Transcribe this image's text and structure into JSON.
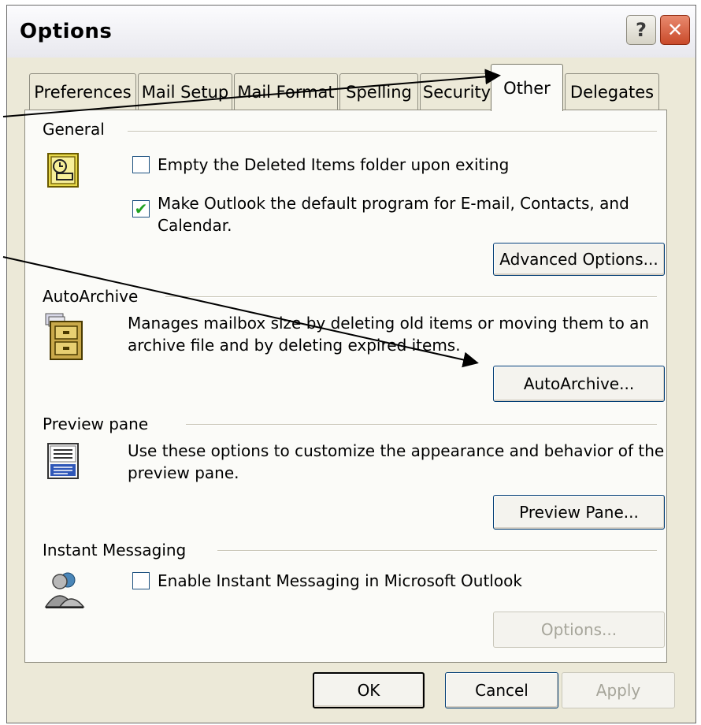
{
  "window": {
    "title": "Options"
  },
  "tabs": [
    {
      "label": "Preferences",
      "active": false
    },
    {
      "label": "Mail Setup",
      "active": false
    },
    {
      "label": "Mail Format",
      "active": false
    },
    {
      "label": "Spelling",
      "active": false
    },
    {
      "label": "Security",
      "active": false
    },
    {
      "label": "Other",
      "active": true
    },
    {
      "label": "Delegates",
      "active": false
    }
  ],
  "general": {
    "label": "General",
    "icon": "outlook-options-icon",
    "empty_deleted": {
      "label": "Empty the Deleted Items folder upon exiting",
      "checked": false
    },
    "default_program": {
      "label": "Make Outlook the default program for E-mail, Contacts, and Calendar.",
      "line1": "Make Outlook the default program for E-mail, Contacts, and",
      "line2": "Calendar.",
      "checked": true
    },
    "advanced_button": "Advanced Options..."
  },
  "autoarchive": {
    "label": "AutoArchive",
    "icon": "filing-cabinet-icon",
    "line1": "Manages mailbox size by deleting old items or moving them to an",
    "line2": "archive file and by deleting expired items.",
    "button": "AutoArchive..."
  },
  "preview": {
    "label": "Preview pane",
    "icon": "preview-pane-icon",
    "line1": "Use these options to customize the appearance and behavior of the",
    "line2": "preview pane.",
    "button": "Preview Pane..."
  },
  "im": {
    "label": "Instant Messaging",
    "icon": "users-icon",
    "enable": {
      "label": "Enable Instant Messaging in Microsoft Outlook",
      "checked": false
    },
    "options_button": "Options..."
  },
  "footer": {
    "ok": "OK",
    "cancel": "Cancel",
    "apply": "Apply"
  },
  "colors": {
    "dialog_bg": "#ece9d8",
    "panel_bg": "#fbfbf8",
    "close_red": "#c94a2a",
    "check_green": "#21a121"
  }
}
